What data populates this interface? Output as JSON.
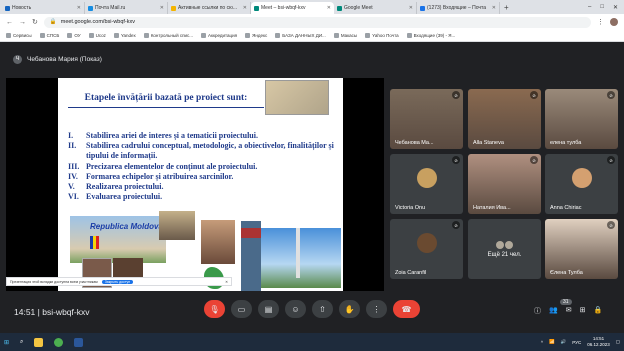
{
  "browser": {
    "tabs": [
      {
        "title": "Новость",
        "color": "#1565c0"
      },
      {
        "title": "Почта Mail.ru",
        "color": "#168de2"
      },
      {
        "title": "Активные ссылки по сю...",
        "color": "#f4b400"
      },
      {
        "title": "Meet – bsi-wbqf-kxv",
        "color": "#00897b"
      },
      {
        "title": "Google Meet",
        "color": "#00897b"
      },
      {
        "title": "(1273) Входящие – Почта",
        "color": "#1a73e8"
      }
    ],
    "new_tab": "+",
    "url": "meet.google.com/bsi-wbqf-kxv",
    "bookmarks": [
      "Сервисы",
      "СПСБ",
      "ОУ",
      "Ucoz",
      "Yandex",
      "Контрольный спис...",
      "Аккредитация",
      "Яндекс",
      "БАЗА ДАННЫХ ДИ...",
      "Макасы",
      "Yahoo Почта",
      "Входящие (39) - Я..."
    ]
  },
  "meet": {
    "presenter_label": "Чебанова Мария (Показ)",
    "presenter_initial": "Ч",
    "meeting_time": "14:51",
    "meeting_code": "bsi-wbqf-kxv",
    "participants_count": "31",
    "slide": {
      "title": "Etapele învățării bazată pe proiect sunt:",
      "items": [
        {
          "num": "I.",
          "text": "Stabilirea ariei de interes și a tematicii proiectului."
        },
        {
          "num": "II.",
          "text": "Stabilirea cadrului conceptual, metodologic, a obiectivelor, finalităților și tipului de informații."
        },
        {
          "num": "III.",
          "text": "Precizarea elementelor de conținut ale proiectului."
        },
        {
          "num": "IV.",
          "text": "Formarea echipelor și atribuirea sarcinilor."
        },
        {
          "num": "V.",
          "text": "Realizarea proiectului."
        },
        {
          "num": "VI.",
          "text": "Evaluarea proiectului."
        }
      ],
      "caption": "Republica Moldova"
    },
    "share_banner": {
      "text": "Презентация этой вкладки доступна всем участникам",
      "button": "Закрыть доступ",
      "close": "✕"
    },
    "participants": [
      {
        "name": "Чебанова Ма...",
        "video": true,
        "color": "#7a6a5a"
      },
      {
        "name": "Alla Staneva",
        "video": true,
        "color": "#8a6a50"
      },
      {
        "name": "елена тулба",
        "video": true,
        "color": "#9a8a7a"
      },
      {
        "name": "Victoria Onu",
        "video": false,
        "color": "#c8a060"
      },
      {
        "name": "Наталия Ива...",
        "video": true,
        "color": "#b09080"
      },
      {
        "name": "Anna Chiriac",
        "video": false,
        "color": "#d4a070"
      },
      {
        "name": "Zoia Caranfil",
        "video": false,
        "color": "#6a4a30"
      },
      {
        "name": "Ещё 21 чел.",
        "video": false,
        "more": true
      },
      {
        "name": "Єлена Тулба",
        "video": true,
        "color": "#e0d0c0"
      }
    ]
  },
  "taskbar": {
    "clock_time": "14:51",
    "clock_date": "06.12.2023",
    "lang": "РУС"
  }
}
